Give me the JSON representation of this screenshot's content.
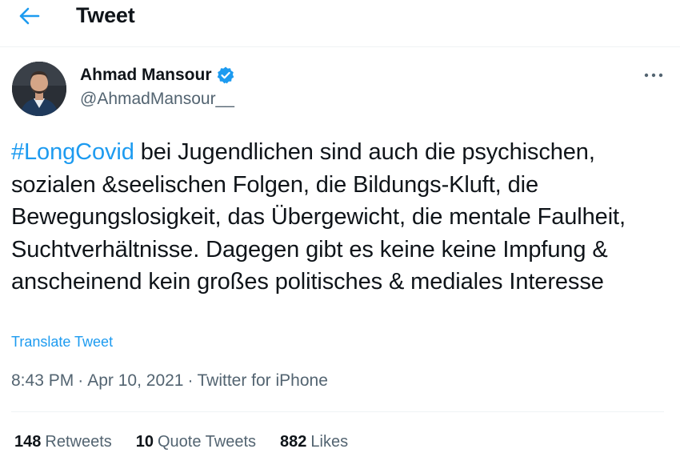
{
  "header": {
    "title": "Tweet"
  },
  "author": {
    "name": "Ahmad Mansour",
    "handle": "@AhmadMansour__"
  },
  "tweet": {
    "hashtag": "#LongCovid",
    "text": " bei Jugendlichen sind auch die psychischen, sozialen &seelischen Folgen, die Bildungs-Kluft, die Bewegungslosigkeit, das Übergewicht, die mentale Faulheit, Suchtverhältnisse. Dagegen gibt es keine keine Impfung & anscheinend kein großes politisches & mediales Interesse",
    "translate_label": "Translate Tweet",
    "time": "8:43 PM",
    "date": "Apr 10, 2021",
    "source": "Twitter for iPhone",
    "separator": "·"
  },
  "stats": {
    "retweets_count": "148",
    "retweets_label": "Retweets",
    "quotes_count": "10",
    "quotes_label": "Quote Tweets",
    "likes_count": "882",
    "likes_label": "Likes"
  },
  "colors": {
    "accent": "#1d9bf0",
    "text": "#0f1419",
    "secondary": "#536471",
    "divider": "#eff3f4"
  },
  "icons": {
    "back": "arrow-left-icon",
    "verified": "verified-badge-icon",
    "more": "more-horizontal-icon"
  }
}
